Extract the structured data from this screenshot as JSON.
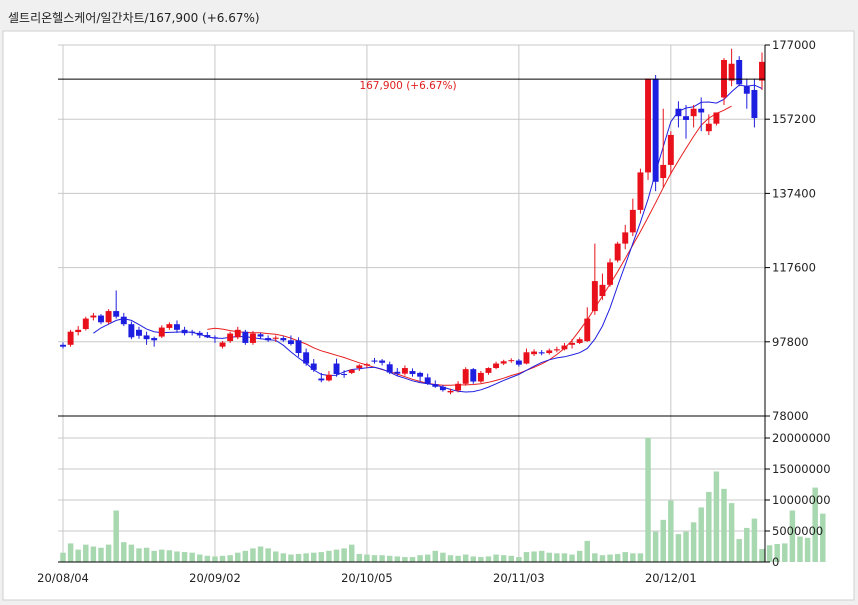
{
  "header": {
    "stock_name": "셀트리온헬스케어",
    "period": "일간차트",
    "price": "167,900",
    "change": "(+6.67%)"
  },
  "chart_data": {
    "type": "candlestick",
    "annotation": "167,900 (+6.67%)",
    "price_axis": {
      "min": 78000,
      "max": 177000,
      "ticks": [
        "177000",
        "157200",
        "137400",
        "117600",
        "97800",
        "78000"
      ]
    },
    "volume_axis": {
      "min": 0,
      "max": 20000000,
      "ticks": [
        "20000000",
        "15000000",
        "10000000",
        "5000000",
        "0"
      ]
    },
    "x_labels": [
      "20/08/04",
      "20/09/02",
      "20/10/05",
      "20/11/03",
      "20/12/01"
    ],
    "x_label_index": [
      0,
      20,
      40,
      60,
      80
    ],
    "last_close": 167900,
    "colors": {
      "up": "#e8111b",
      "down": "#1e1ee0",
      "ma5": "#1e1ee0",
      "ma20": "#e81e1e",
      "volume": "#a8d8b0",
      "grid": "#c8c8c8",
      "frame": "#000000"
    },
    "moving_averages": {
      "ma5": [
        null,
        null,
        null,
        null,
        100100,
        101500,
        102500,
        103500,
        104000,
        103500,
        102400,
        101200,
        100500,
        100200,
        100300,
        100400,
        100500,
        100300,
        99800,
        99100,
        98800,
        98700,
        99000,
        99200,
        99200,
        98900,
        98600,
        98400,
        98200,
        96900,
        95100,
        93500,
        92100,
        90300,
        89100,
        88800,
        88900,
        89800,
        90400,
        90600,
        90900,
        91000,
        90500,
        89700,
        88700,
        88100,
        87400,
        86900,
        86600,
        86300,
        85700,
        85100,
        84600,
        84400,
        84500,
        85000,
        85700,
        86600,
        87500,
        88300,
        89100,
        90200,
        91300,
        92300,
        93000,
        93500,
        93800,
        94300,
        94900,
        96000,
        98500,
        102000,
        106800,
        112700,
        118300,
        124000,
        129700,
        135800,
        143000,
        149800,
        156500,
        159300,
        160200,
        160500,
        161700,
        161800,
        161500,
        162500,
        164500,
        166300,
        166000,
        166300,
        165400
      ],
      "ma20": [
        null,
        null,
        null,
        null,
        null,
        null,
        null,
        null,
        null,
        null,
        null,
        null,
        null,
        null,
        null,
        null,
        null,
        null,
        null,
        101100,
        101400,
        101200,
        100800,
        100500,
        100300,
        100200,
        100200,
        100000,
        99800,
        99400,
        98800,
        98000,
        97200,
        96200,
        95400,
        94800,
        94200,
        93600,
        92900,
        92200,
        91600,
        91000,
        90400,
        89800,
        89200,
        88500,
        87800,
        87200,
        86700,
        86400,
        86200,
        86200,
        86300,
        86300,
        86400,
        86600,
        87000,
        87500,
        88100,
        88800,
        89400,
        90200,
        91000,
        91900,
        93000,
        94400,
        96100,
        98200,
        100900,
        103700,
        106800,
        110000,
        113200,
        116500,
        120000,
        123600,
        127200,
        131000,
        134900,
        138900,
        142700,
        146100,
        149400,
        152600,
        155600,
        157500,
        158700,
        159600,
        160700
      ]
    },
    "candles": [
      {
        "o": 97000,
        "h": 97600,
        "l": 96000,
        "c": 96500
      },
      {
        "o": 97000,
        "h": 101000,
        "l": 96500,
        "c": 100500
      },
      {
        "o": 100400,
        "h": 102000,
        "l": 99500,
        "c": 101000
      },
      {
        "o": 101200,
        "h": 104500,
        "l": 100800,
        "c": 104000
      },
      {
        "o": 104300,
        "h": 105500,
        "l": 103500,
        "c": 104800
      },
      {
        "o": 104800,
        "h": 105200,
        "l": 102500,
        "c": 103000
      },
      {
        "o": 103000,
        "h": 106500,
        "l": 102500,
        "c": 106000
      },
      {
        "o": 106000,
        "h": 111500,
        "l": 104000,
        "c": 104500
      },
      {
        "o": 104500,
        "h": 105500,
        "l": 102000,
        "c": 102500
      },
      {
        "o": 102500,
        "h": 103200,
        "l": 98500,
        "c": 99000
      },
      {
        "o": 101000,
        "h": 101800,
        "l": 98600,
        "c": 99400
      },
      {
        "o": 99500,
        "h": 100500,
        "l": 97000,
        "c": 98500
      },
      {
        "o": 98800,
        "h": 99200,
        "l": 96500,
        "c": 98200
      },
      {
        "o": 99200,
        "h": 102200,
        "l": 98800,
        "c": 101600
      },
      {
        "o": 101500,
        "h": 103000,
        "l": 101000,
        "c": 102500
      },
      {
        "o": 102500,
        "h": 103500,
        "l": 100200,
        "c": 101000
      },
      {
        "o": 101000,
        "h": 101800,
        "l": 99500,
        "c": 100100
      },
      {
        "o": 100500,
        "h": 101000,
        "l": 99500,
        "c": 100300
      },
      {
        "o": 100200,
        "h": 100700,
        "l": 98800,
        "c": 99500
      },
      {
        "o": 99600,
        "h": 100400,
        "l": 98800,
        "c": 99000
      },
      {
        "o": 99000,
        "h": 99500,
        "l": 97500,
        "c": 98900
      },
      {
        "o": 96500,
        "h": 98000,
        "l": 96000,
        "c": 97600
      },
      {
        "o": 98000,
        "h": 100500,
        "l": 97500,
        "c": 100000
      },
      {
        "o": 99000,
        "h": 101800,
        "l": 98500,
        "c": 101000
      },
      {
        "o": 100500,
        "h": 101000,
        "l": 97000,
        "c": 97500
      },
      {
        "o": 97500,
        "h": 100700,
        "l": 97000,
        "c": 100000
      },
      {
        "o": 99800,
        "h": 100200,
        "l": 98600,
        "c": 99200
      },
      {
        "o": 98800,
        "h": 99500,
        "l": 97800,
        "c": 98200
      },
      {
        "o": 98600,
        "h": 99500,
        "l": 97800,
        "c": 98900
      },
      {
        "o": 98800,
        "h": 99300,
        "l": 97800,
        "c": 98200
      },
      {
        "o": 98200,
        "h": 99500,
        "l": 96800,
        "c": 97200
      },
      {
        "o": 98200,
        "h": 99000,
        "l": 93800,
        "c": 94800
      },
      {
        "o": 95000,
        "h": 96000,
        "l": 91400,
        "c": 92000
      },
      {
        "o": 92000,
        "h": 93200,
        "l": 89800,
        "c": 90300
      },
      {
        "o": 88000,
        "h": 89500,
        "l": 87000,
        "c": 87500
      },
      {
        "o": 87500,
        "h": 90000,
        "l": 87200,
        "c": 89000
      },
      {
        "o": 92000,
        "h": 93300,
        "l": 88500,
        "c": 89200
      },
      {
        "o": 89200,
        "h": 90200,
        "l": 88200,
        "c": 89000
      },
      {
        "o": 89500,
        "h": 90500,
        "l": 89200,
        "c": 90300
      },
      {
        "o": 90800,
        "h": 91800,
        "l": 90000,
        "c": 91500
      },
      {
        "o": 91500,
        "h": 92200,
        "l": 90800,
        "c": 91800
      },
      {
        "o": 92800,
        "h": 93500,
        "l": 92000,
        "c": 92500
      },
      {
        "o": 92800,
        "h": 93200,
        "l": 91500,
        "c": 92200
      },
      {
        "o": 91800,
        "h": 92500,
        "l": 89200,
        "c": 89600
      },
      {
        "o": 89800,
        "h": 90800,
        "l": 88800,
        "c": 89300
      },
      {
        "o": 89300,
        "h": 91500,
        "l": 88800,
        "c": 90800
      },
      {
        "o": 90000,
        "h": 90700,
        "l": 88500,
        "c": 89200
      },
      {
        "o": 89500,
        "h": 89800,
        "l": 87200,
        "c": 88500
      },
      {
        "o": 88300,
        "h": 89300,
        "l": 86300,
        "c": 86600
      },
      {
        "o": 86500,
        "h": 87500,
        "l": 85500,
        "c": 85800
      },
      {
        "o": 85800,
        "h": 86300,
        "l": 84500,
        "c": 84900
      },
      {
        "o": 84300,
        "h": 85300,
        "l": 83800,
        "c": 84700
      },
      {
        "o": 84800,
        "h": 87300,
        "l": 84300,
        "c": 86600
      },
      {
        "o": 86600,
        "h": 91000,
        "l": 86100,
        "c": 90500
      },
      {
        "o": 90500,
        "h": 90800,
        "l": 86600,
        "c": 87200
      },
      {
        "o": 87200,
        "h": 90000,
        "l": 86800,
        "c": 89500
      },
      {
        "o": 89500,
        "h": 91000,
        "l": 89000,
        "c": 90800
      },
      {
        "o": 90800,
        "h": 92500,
        "l": 90500,
        "c": 92000
      },
      {
        "o": 92000,
        "h": 93000,
        "l": 91600,
        "c": 92600
      },
      {
        "o": 92800,
        "h": 93400,
        "l": 92200,
        "c": 92900
      },
      {
        "o": 92800,
        "h": 93200,
        "l": 91200,
        "c": 91700
      },
      {
        "o": 92000,
        "h": 96000,
        "l": 91800,
        "c": 95000
      },
      {
        "o": 94500,
        "h": 95800,
        "l": 94000,
        "c": 95200
      },
      {
        "o": 95000,
        "h": 95600,
        "l": 94200,
        "c": 94700
      },
      {
        "o": 94800,
        "h": 96000,
        "l": 94400,
        "c": 95500
      },
      {
        "o": 95500,
        "h": 96500,
        "l": 95000,
        "c": 95800
      },
      {
        "o": 95800,
        "h": 97500,
        "l": 95500,
        "c": 96800
      },
      {
        "o": 97000,
        "h": 98500,
        "l": 96000,
        "c": 97500
      },
      {
        "o": 97500,
        "h": 99000,
        "l": 97200,
        "c": 98500
      },
      {
        "o": 98000,
        "h": 107000,
        "l": 97800,
        "c": 104000
      },
      {
        "o": 106000,
        "h": 124000,
        "l": 105000,
        "c": 114000
      },
      {
        "o": 110000,
        "h": 116000,
        "l": 109000,
        "c": 113000
      },
      {
        "o": 113000,
        "h": 120000,
        "l": 112500,
        "c": 119000
      },
      {
        "o": 119500,
        "h": 124500,
        "l": 119000,
        "c": 124000
      },
      {
        "o": 124000,
        "h": 129000,
        "l": 122500,
        "c": 127000
      },
      {
        "o": 127000,
        "h": 136000,
        "l": 126000,
        "c": 133000
      },
      {
        "o": 133000,
        "h": 144000,
        "l": 132000,
        "c": 143000
      },
      {
        "o": 143000,
        "h": 168000,
        "l": 141000,
        "c": 168000
      },
      {
        "o": 168000,
        "h": 169000,
        "l": 138000,
        "c": 140500
      },
      {
        "o": 141500,
        "h": 160000,
        "l": 139000,
        "c": 145000
      },
      {
        "o": 145000,
        "h": 154000,
        "l": 142500,
        "c": 153000
      },
      {
        "o": 160000,
        "h": 162000,
        "l": 155000,
        "c": 158000
      },
      {
        "o": 158000,
        "h": 161000,
        "l": 152000,
        "c": 157000
      },
      {
        "o": 158000,
        "h": 161000,
        "l": 155000,
        "c": 160000
      },
      {
        "o": 160000,
        "h": 163000,
        "l": 154000,
        "c": 159000
      },
      {
        "o": 154000,
        "h": 158500,
        "l": 153000,
        "c": 156000
      },
      {
        "o": 156000,
        "h": 159000,
        "l": 155500,
        "c": 159000
      },
      {
        "o": 163000,
        "h": 173500,
        "l": 161000,
        "c": 173000
      },
      {
        "o": 167500,
        "h": 176000,
        "l": 166000,
        "c": 172000
      },
      {
        "o": 173000,
        "h": 174000,
        "l": 166000,
        "c": 166500
      },
      {
        "o": 166000,
        "h": 168000,
        "l": 160000,
        "c": 164000
      },
      {
        "o": 165000,
        "h": 168000,
        "l": 155000,
        "c": 157500
      },
      {
        "o": 167500,
        "h": 175000,
        "l": 165000,
        "c": 172500
      }
    ],
    "volume": [
      1500000,
      3000000,
      2000000,
      2800000,
      2500000,
      2300000,
      2800000,
      8300000,
      3200000,
      2800000,
      2200000,
      2300000,
      1800000,
      2000000,
      1900000,
      1700000,
      1600000,
      1500000,
      1200000,
      1000000,
      900000,
      1000000,
      1100000,
      1500000,
      1800000,
      2200000,
      2500000,
      2200000,
      1700000,
      1400000,
      1200000,
      1300000,
      1400000,
      1500000,
      1600000,
      1800000,
      2000000,
      2200000,
      2800000,
      1300000,
      1200000,
      1100000,
      1100000,
      1000000,
      900000,
      800000,
      800000,
      1100000,
      1200000,
      1800000,
      1500000,
      1100000,
      1000000,
      1200000,
      900000,
      800000,
      900000,
      1200000,
      1100000,
      1000000,
      800000,
      1600000,
      1700000,
      1800000,
      1500000,
      1400000,
      1400000,
      1200000,
      1800000,
      3400000,
      1400000,
      1100000,
      1200000,
      1300000,
      1600000,
      1400000,
      1400000,
      20000000,
      4900000,
      6800000,
      9900000,
      4500000,
      4900000,
      6400000,
      8800000,
      11300000,
      14600000,
      11800000,
      9500000,
      3700000,
      5500000,
      7000000,
      2100000,
      2700000,
      2900000,
      3000000,
      8300000,
      4100000,
      3900000,
      12000000,
      7800000
    ]
  }
}
